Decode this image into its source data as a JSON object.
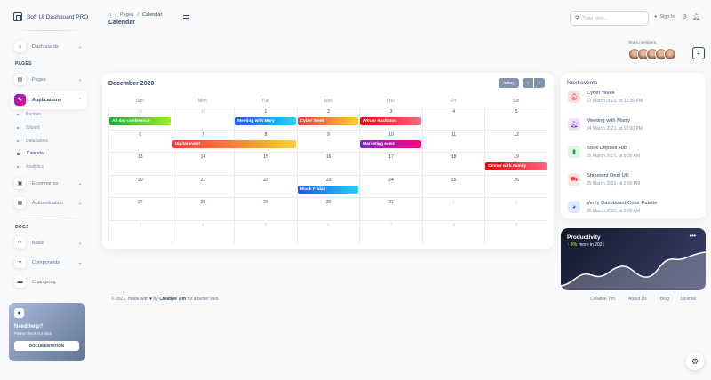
{
  "brand": "Soft UI Dashboard PRO",
  "sidebar": {
    "dashboards": "Dashboards",
    "pages_section": "PAGES",
    "pages": "Pages",
    "applications": "Applications",
    "app_items": [
      "Kanban",
      "Wizard",
      "DataTables",
      "Calendar",
      "Analytics"
    ],
    "ecommerce": "Ecommerce",
    "authentication": "Authentication",
    "docs_section": "DOCS",
    "basic": "Basic",
    "components": "Components",
    "changelog": "Changelog",
    "help_title": "Need help?",
    "help_sub": "Please check our docs",
    "help_button": "DOCUMENTATION"
  },
  "header": {
    "breadcrumb_home_icon": "home-icon",
    "breadcrumb_pages": "Pages",
    "breadcrumb_current": "Calendar",
    "title": "Calendar",
    "search_placeholder": "Type here...",
    "signin": "Sign In"
  },
  "team": {
    "label": "Team members:"
  },
  "calendar": {
    "title": "December 2020",
    "today": "today",
    "prev": "‹",
    "next": "›",
    "days": [
      "Sun",
      "Mon",
      "Tue",
      "Wed",
      "Thu",
      "Fri",
      "Sat"
    ],
    "dates": [
      "29",
      "30",
      "1",
      "2",
      "3",
      "4",
      "5",
      "6",
      "7",
      "8",
      "9",
      "10",
      "11",
      "12",
      "13",
      "14",
      "15",
      "16",
      "17",
      "18",
      "19",
      "20",
      "21",
      "22",
      "23",
      "24",
      "25",
      "26",
      "27",
      "28",
      "29",
      "30",
      "31",
      "1",
      "2",
      "3",
      "4",
      "5",
      "6",
      "7",
      "8",
      "9"
    ],
    "events": {
      "all_day": "All day conference",
      "meeting": "Meeting with Mary",
      "cyber": "Cyber Week",
      "hackathon": "Winter Hackaton",
      "digital": "Digital event",
      "marketing": "Marketing event",
      "dinner": "Dinner with Family",
      "black_friday": "Black Friday"
    }
  },
  "next_events": {
    "title": "Next events",
    "items": [
      {
        "title": "Cyber Week",
        "date": "27 March 2021, at 12:30 PM",
        "icon": "bell-icon",
        "color": "#ea0606"
      },
      {
        "title": "Meeting with Marry",
        "date": "24 March 2021, at 10:00 PM",
        "icon": "bell-icon",
        "color": "#7928ca"
      },
      {
        "title": "Book Deposit Hall",
        "date": "25 March 2021, at 9:30 AM",
        "icon": "book-icon",
        "color": "#17ad37"
      },
      {
        "title": "Shipment Deal UK",
        "date": "25 March 2021, at 2:00 PM",
        "icon": "truck-icon",
        "color": "#f53939"
      },
      {
        "title": "Verify Dashboard Color Palette",
        "date": "26 March 2021, at 9:00 AM",
        "icon": "palette-icon",
        "color": "#2152ff"
      }
    ]
  },
  "productivity": {
    "title": "Productivity",
    "change": "4%",
    "suffix": "more in 2021"
  },
  "footer": {
    "prefix": "© 2021, made with",
    "by": "by",
    "author": "Creative Tim",
    "suffix": "for a better web.",
    "links": [
      "Creative Tim",
      "About Us",
      "Blog",
      "License"
    ]
  }
}
